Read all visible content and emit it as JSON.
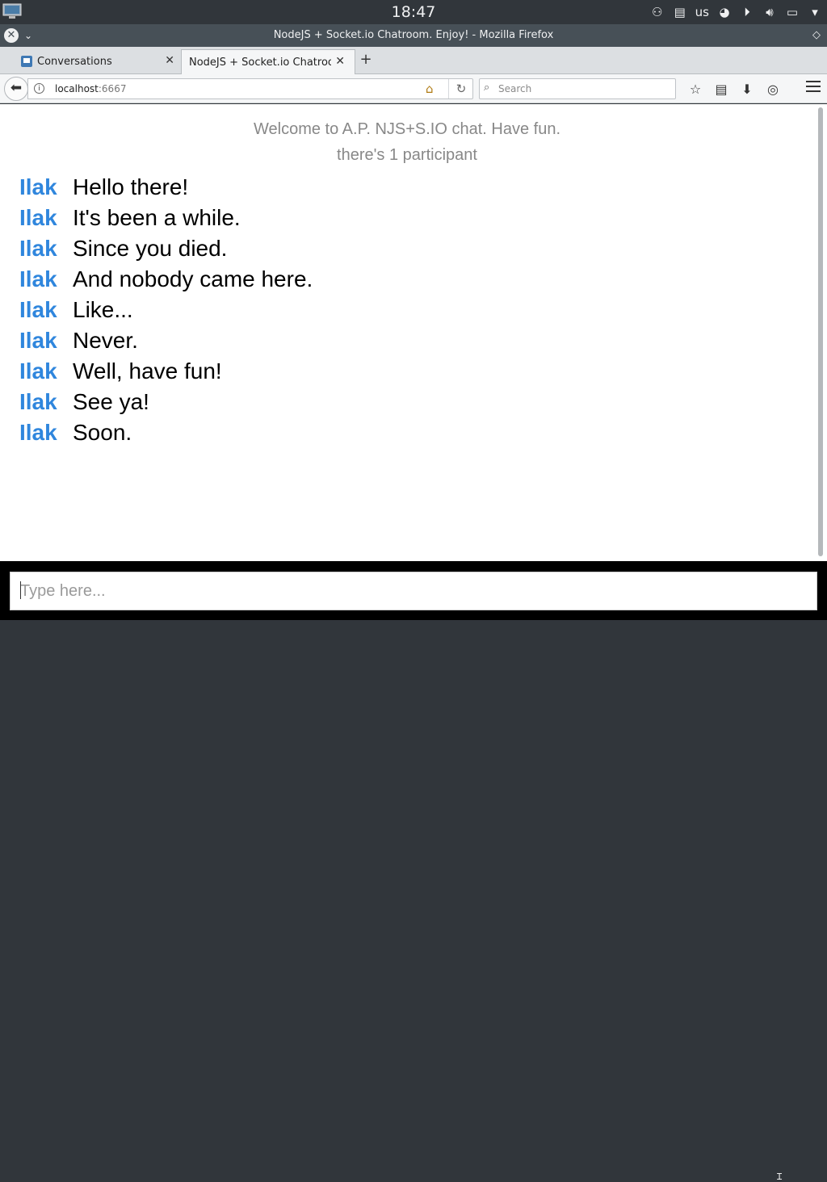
{
  "system_panel": {
    "clock": "18:47",
    "keyboard_layout": "us",
    "tray_icons": [
      "user-switch-icon",
      "clipboard-icon",
      "keyboard-layout",
      "network-globe-icon",
      "media-player-icon",
      "volume-icon",
      "display-icon",
      "tray-expand-icon"
    ]
  },
  "window": {
    "title": "NodeJS + Socket.io Chatroom. Enjoy! - Mozilla Firefox"
  },
  "tabs": [
    {
      "label": "Conversations",
      "active": false,
      "close": "✕"
    },
    {
      "label": "NodeJS + Socket.io Chatroo...",
      "active": true,
      "close": "✕"
    }
  ],
  "new_tab_label": "+",
  "navbar": {
    "url_host": "localhost",
    "url_port": ":6667",
    "search_placeholder": "Search"
  },
  "chat": {
    "welcome": "Welcome to A.P. NJS+S.IO chat. Have fun.",
    "participants": "there's 1 participant",
    "messages": [
      {
        "user": "Ilak",
        "text": "Hello there!"
      },
      {
        "user": "Ilak",
        "text": "It's been a while."
      },
      {
        "user": "Ilak",
        "text": "Since you died."
      },
      {
        "user": "Ilak",
        "text": "And nobody came here."
      },
      {
        "user": "Ilak",
        "text": "Like..."
      },
      {
        "user": "Ilak",
        "text": "Never."
      },
      {
        "user": "Ilak",
        "text": "Well, have fun!"
      },
      {
        "user": "Ilak",
        "text": "See ya!"
      },
      {
        "user": "Ilak",
        "text": "Soon."
      }
    ],
    "input_placeholder": "Type here...",
    "input_value": ""
  },
  "colors": {
    "username": "#2f86dd",
    "panel": "#31363b",
    "titlebar": "#475057"
  }
}
